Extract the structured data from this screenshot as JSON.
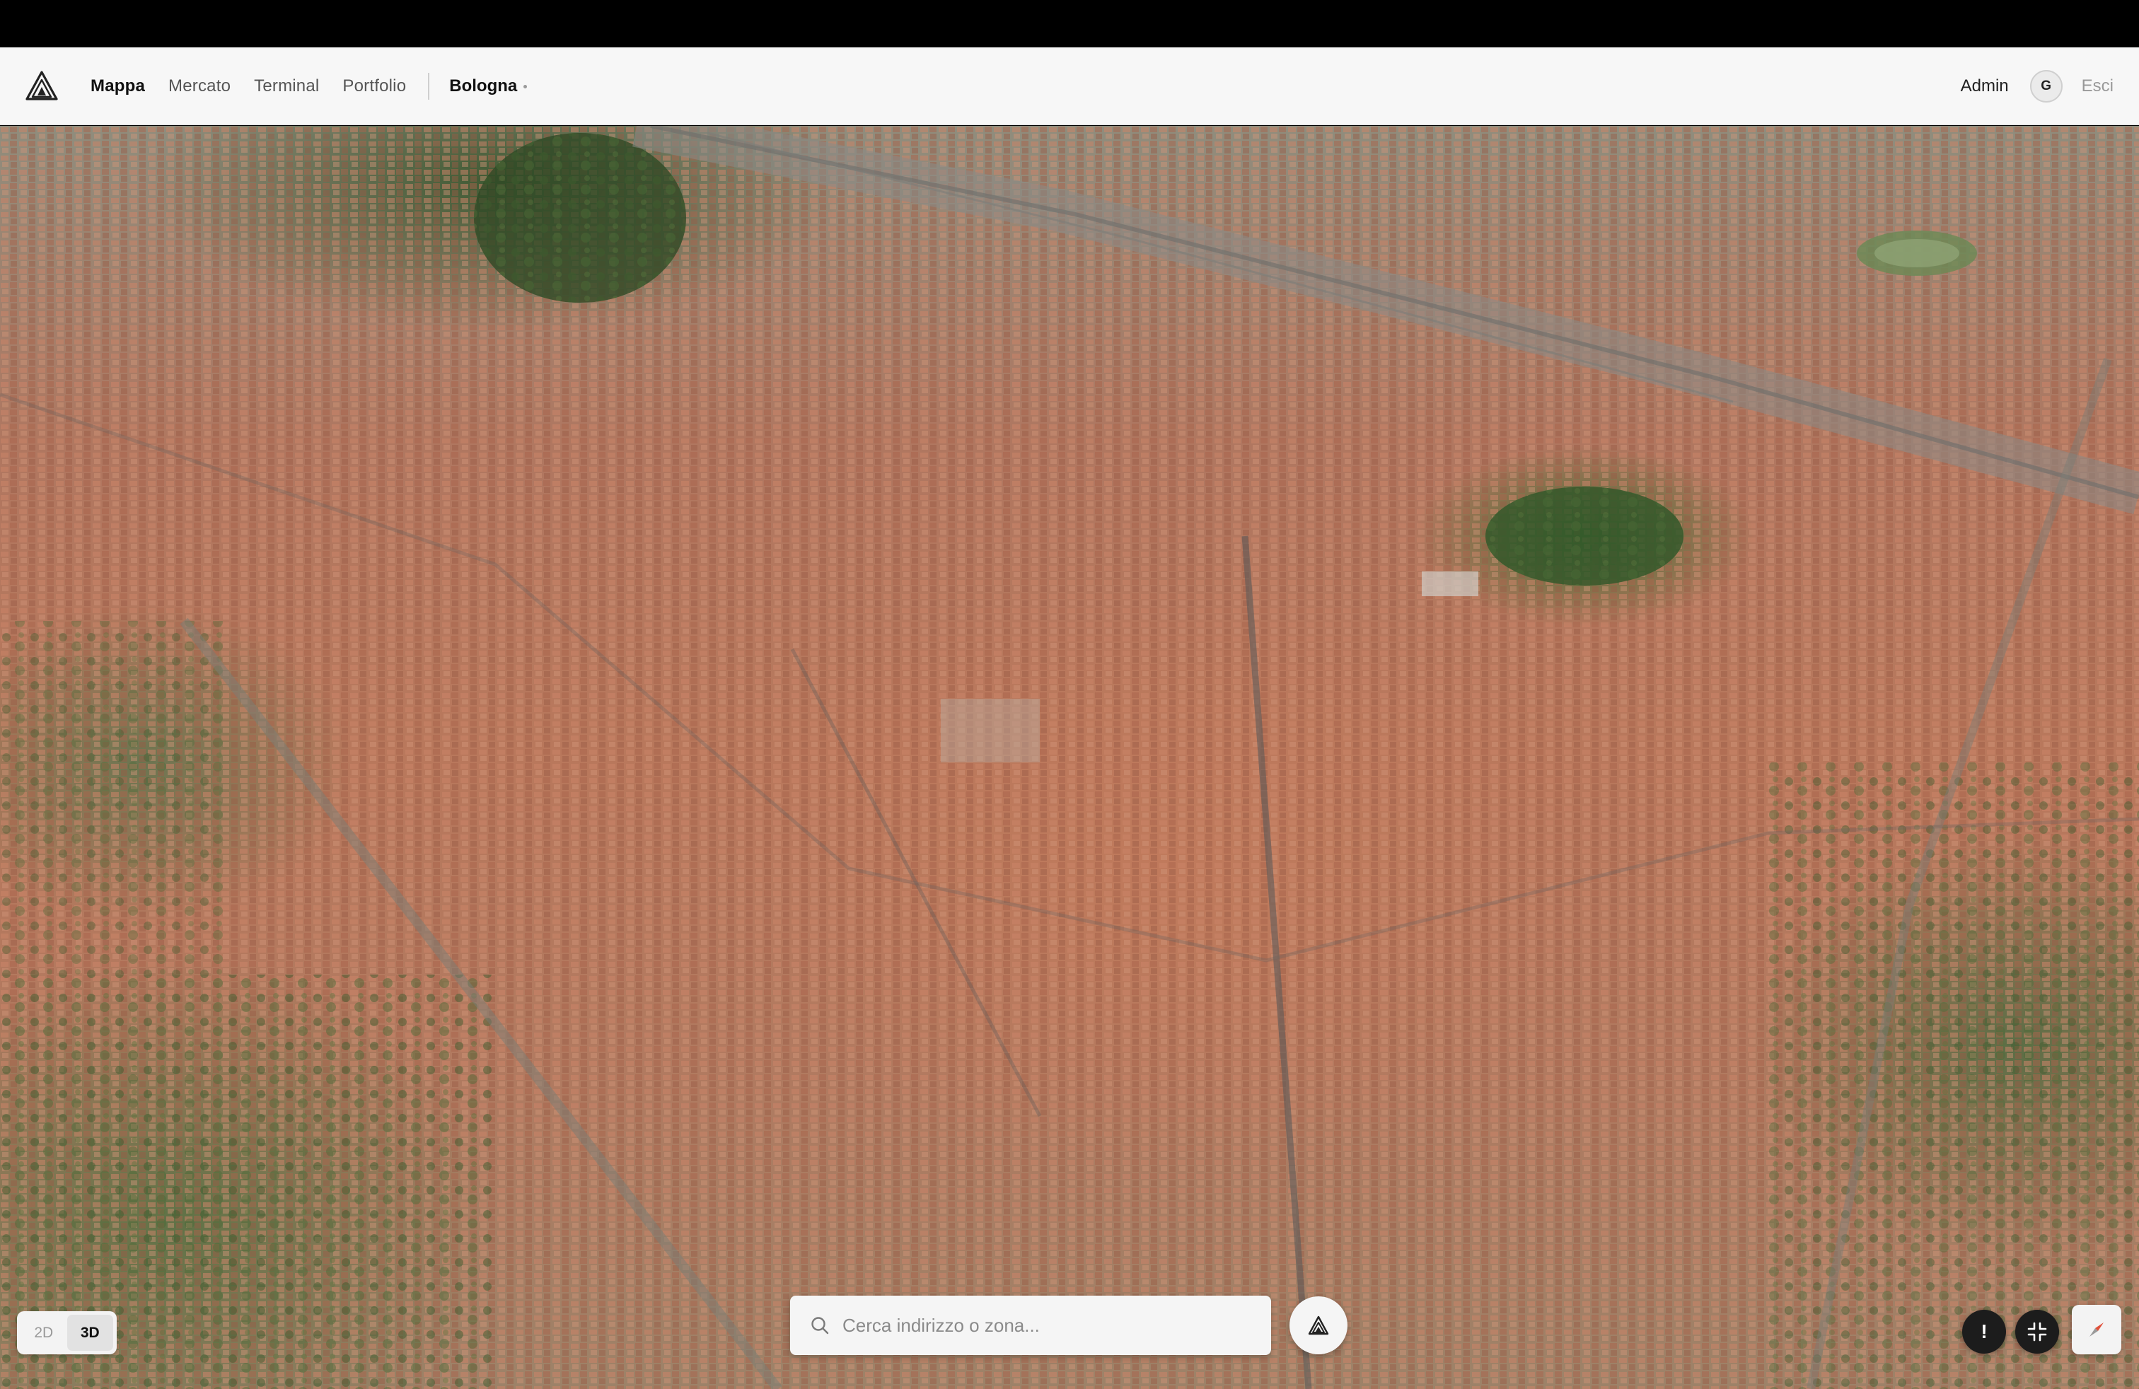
{
  "nav": {
    "links": [
      {
        "label": "Mappa",
        "active": true
      },
      {
        "label": "Mercato",
        "active": false
      },
      {
        "label": "Terminal",
        "active": false
      },
      {
        "label": "Portfolio",
        "active": false
      }
    ],
    "city": "Bologna",
    "user": "Admin",
    "avatar_initial": "G",
    "logout_label": "Esci"
  },
  "map": {
    "view_modes": [
      {
        "label": "2D",
        "active": false
      },
      {
        "label": "3D",
        "active": true
      }
    ],
    "search_placeholder": "Cerca indirizzo o zona...",
    "alert_glyph": "!"
  },
  "icons": {
    "logo": "triangle-logo-icon",
    "search": "search-icon",
    "ai": "triangle-ai-icon",
    "collapse": "collapse-icon",
    "compass": "compass-icon"
  },
  "colors": {
    "navbar_bg": "#f7f7f7",
    "accent_dark": "#1c1c1c",
    "compass_red": "#e0503a"
  }
}
